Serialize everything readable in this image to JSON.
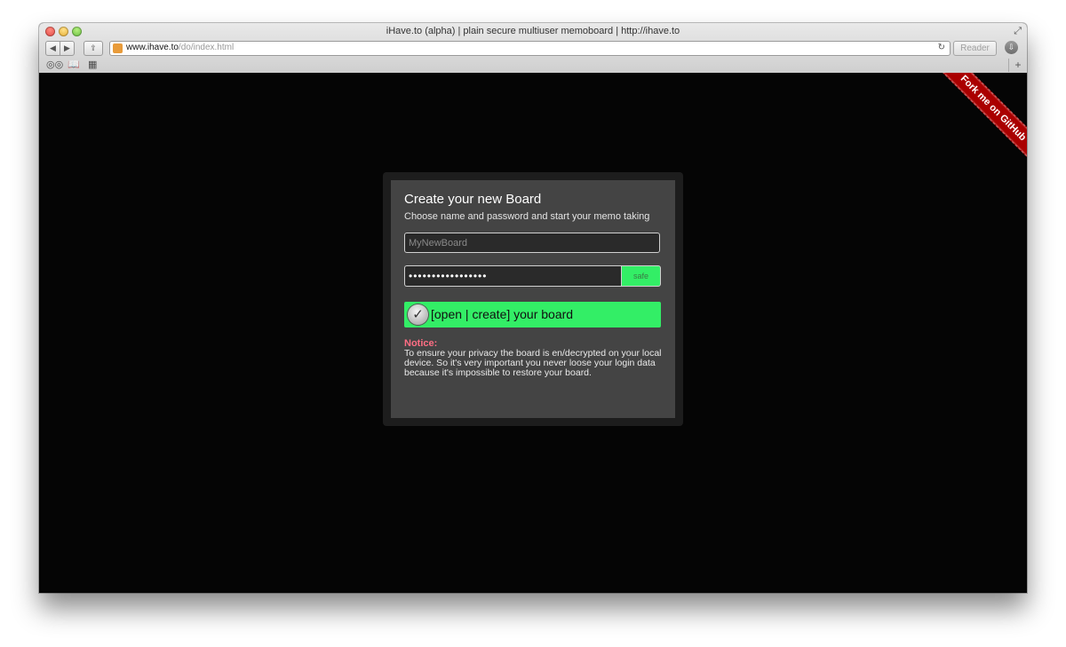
{
  "window": {
    "title": "iHave.to (alpha) | plain secure multiuser memoboard | http://ihave.to"
  },
  "toolbar": {
    "back_icon": "◀",
    "forward_icon": "▶",
    "share_icon": "⇪",
    "url_host": "www.ihave.to",
    "url_path": "/do/index.html",
    "reload_icon": "↻",
    "reader_label": "Reader",
    "downloads_icon": "⇩",
    "fullscreen_icon": "⤢"
  },
  "bookmarks": {
    "reading_list_icon": "◎◎",
    "book_icon": "📖",
    "grid_icon": "▦",
    "new_tab_icon": "+"
  },
  "ribbon": {
    "label": "Fork me on GitHub",
    "color": "#aa0000"
  },
  "board_form": {
    "title": "Create your new Board",
    "subtitle": "Choose name and password and start your memo taking",
    "name_placeholder": "MyNewBoard",
    "password_value": "•••••••••••••••••",
    "strength_label": "safe",
    "submit_icon": "✓",
    "submit_label": "[open | create] your board",
    "accent_color": "#33ee66"
  },
  "notice": {
    "title": "Notice:",
    "text": "To ensure your privacy the board is en/decrypted on your local device. So it's very important you never loose your login data because it's impossible to restore your board."
  }
}
